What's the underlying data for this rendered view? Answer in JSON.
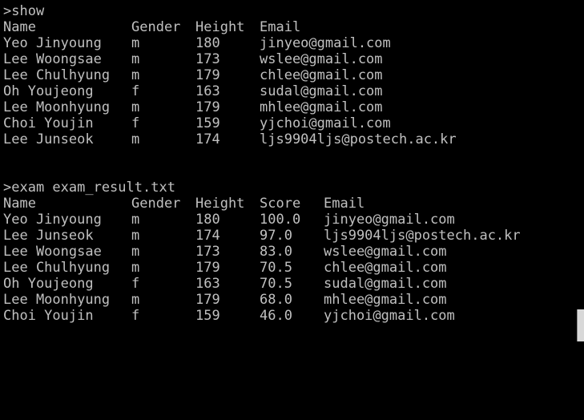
{
  "terminal": {
    "text_color": "#c0c0c0",
    "background": "#000000",
    "show_command": ">show",
    "exam_command": ">exam exam_result.txt"
  },
  "show_table": {
    "headers": {
      "name": "Name",
      "gender": "Gender",
      "height": "Height",
      "email": "Email"
    },
    "rows": [
      {
        "name": "Yeo Jinyoung",
        "gender": "m",
        "height": "180",
        "email": "jinyeo@gmail.com"
      },
      {
        "name": "Lee Woongsae",
        "gender": "m",
        "height": "173",
        "email": "wslee@gmail.com"
      },
      {
        "name": "Lee Chulhyung",
        "gender": "m",
        "height": "179",
        "email": "chlee@gmail.com"
      },
      {
        "name": "Oh Youjeong",
        "gender": "f",
        "height": "163",
        "email": "sudal@gmail.com"
      },
      {
        "name": "Lee Moonhyung",
        "gender": "m",
        "height": "179",
        "email": "mhlee@gmail.com"
      },
      {
        "name": "Choi Youjin",
        "gender": "f",
        "height": "159",
        "email": "yjchoi@gmail.com"
      },
      {
        "name": "Lee Junseok",
        "gender": "m",
        "height": "174",
        "email": "ljs9904ljs@postech.ac.kr"
      }
    ]
  },
  "exam_table": {
    "headers": {
      "name": "Name",
      "gender": "Gender",
      "height": "Height",
      "score": "Score",
      "email": "Email"
    },
    "rows": [
      {
        "name": "Yeo Jinyoung",
        "gender": "m",
        "height": "180",
        "score": "100.0",
        "email": "jinyeo@gmail.com"
      },
      {
        "name": "Lee Junseok",
        "gender": "m",
        "height": "174",
        "score": "97.0",
        "email": "ljs9904ljs@postech.ac.kr"
      },
      {
        "name": "Lee Woongsae",
        "gender": "m",
        "height": "173",
        "score": "83.0",
        "email": "wslee@gmail.com"
      },
      {
        "name": "Lee Chulhyung",
        "gender": "m",
        "height": "179",
        "score": "70.5",
        "email": "chlee@gmail.com"
      },
      {
        "name": "Oh Youjeong",
        "gender": "f",
        "height": "163",
        "score": "70.5",
        "email": "sudal@gmail.com"
      },
      {
        "name": "Lee Moonhyung",
        "gender": "m",
        "height": "179",
        "score": "68.0",
        "email": "mhlee@gmail.com"
      },
      {
        "name": "Choi Youjin",
        "gender": "f",
        "height": "159",
        "score": "46.0",
        "email": "yjchoi@gmail.com"
      }
    ]
  }
}
